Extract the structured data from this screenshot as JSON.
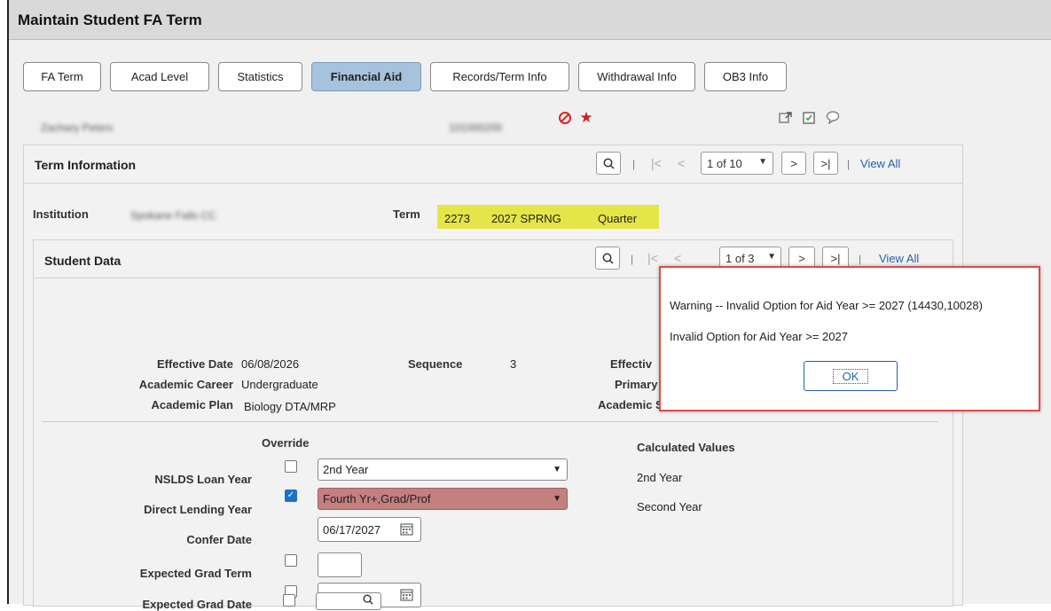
{
  "page": {
    "title": "Maintain Student FA Term"
  },
  "tabs": [
    {
      "label": "FA Term"
    },
    {
      "label": "Acad Level"
    },
    {
      "label": "Statistics"
    },
    {
      "label": "Financial Aid",
      "active": true
    },
    {
      "label": "Records/Term Info"
    },
    {
      "label": "Withdrawal Info"
    },
    {
      "label": "OB3 Info"
    }
  ],
  "student": {
    "name": "Zachary Peters",
    "id": "101000200"
  },
  "header_icons": [
    "prohibited-icon",
    "star-icon",
    "related-content-icon",
    "notes-icon",
    "comments-icon"
  ],
  "term_info": {
    "title": "Term Information",
    "page_count": "1 of 10",
    "view_all": "View All",
    "institution_label": "Institution",
    "institution_value": "Spokane Falls CC",
    "term_label": "Term",
    "term_code": "2273",
    "term_desc": "2027 SPRNG",
    "term_type": "Quarter"
  },
  "student_data": {
    "title": "Student Data",
    "page_count": "1 of 3",
    "view_all": "View All",
    "effective_date_label": "Effective Date",
    "effective_date": "06/08/2026",
    "sequence_label": "Sequence",
    "sequence": "3",
    "effective_label_cut": "Effectiv",
    "career_label": "Academic Career",
    "career": "Undergraduate",
    "primary_label_cut": "Primary",
    "plan_label": "Academic Plan",
    "plan": "Biology DTA/MRP",
    "academic_label_cut": "Academic S",
    "override_label": "Override",
    "calc_label": "Calculated Values",
    "nslds_label": "NSLDS Loan Year",
    "nslds_value": "2nd Year",
    "nslds_calc": "2nd Year",
    "dl_label": "Direct Lending Year",
    "dl_value": "Fourth Yr+,Grad/Prof",
    "dl_calc": "Second Year",
    "confer_label": "Confer Date",
    "confer_value": "06/17/2027",
    "egt_label": "Expected Grad Term",
    "egt_value": "",
    "egd_label": "Expected Grad Date",
    "egd_value": ""
  },
  "dialog": {
    "line1": "Warning -- Invalid Option for Aid Year >= 2027 (14430,10028)",
    "line2": "Invalid Option for Aid Year >= 2027",
    "ok": "OK"
  },
  "colors": {
    "active_tab": "#a7c2dc",
    "highlight": "#e5e548",
    "error_field": "#c47f7f",
    "link": "#2662a8",
    "dialog_border": "#e04a4a"
  }
}
